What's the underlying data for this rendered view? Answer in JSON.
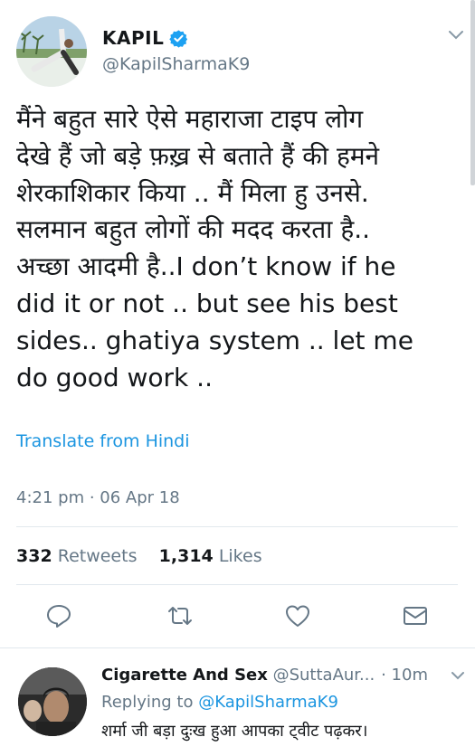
{
  "tweet": {
    "author_name": "KAPIL",
    "author_handle": "@KapilSharmaK9",
    "text_lines": [
      "मैंने बहुत सारे ऐसे महाराजा टाइप लोग",
      "देखे हैं जो बड़े फ़ख़्र से बताते हैं की हमने",
      "शेरकाशिकार किया .. मैं मिला हु  उनसे.",
      "सलमान बहुत लोगों की मदद करता है..",
      "अच्छा आदमी है..I don’t know if he",
      "did it or not .. but see his best",
      "sides.. ghatiya system .. let me",
      "do good work .."
    ],
    "translate_label": "Translate from Hindi",
    "timestamp": "4:21 pm · 06 Apr 18",
    "retweets_count": "332",
    "retweets_label": "Retweets",
    "likes_count": "1,314",
    "likes_label": "Likes"
  },
  "icons": {
    "verified": "verified-badge-icon",
    "menu": "chevron-down-icon",
    "reply": "reply-icon",
    "retweet": "retweet-icon",
    "like": "heart-icon",
    "dm": "envelope-icon"
  },
  "reply_tweet": {
    "author_name": "Cigarette And Sex",
    "author_handle": "@SuttaAur...",
    "time": "· 10m",
    "replying_to_label": "Replying to",
    "replying_to_handle": "@KapilSharmaK9",
    "text": "शर्मा जी बड़ा दुःख हुआ आपका ट्वीट पढ़कर।"
  },
  "colors": {
    "link": "#1b95e0",
    "secondary_text": "#657786",
    "primary_text": "#14171a",
    "divider": "#e1e8ed"
  }
}
